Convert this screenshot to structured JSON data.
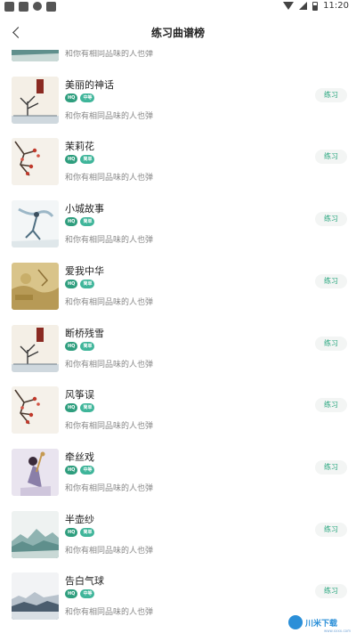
{
  "status_bar": {
    "time": "11:20",
    "left_icons": [
      "shield-icon",
      "image-icon",
      "bug-icon",
      "text-icon"
    ],
    "right_icons": [
      "wifi-icon",
      "signal-icon",
      "battery-icon"
    ]
  },
  "header": {
    "title": "练习曲谱榜",
    "back_icon": "chevron-left-icon"
  },
  "list": {
    "practice_label": "练习",
    "subtitle": "和你有相同品味的人也弹",
    "items": [
      {
        "title": "",
        "badges": [
          "HQ",
          "中等"
        ],
        "art": "landscape"
      },
      {
        "title": "美丽的神话",
        "badges": [
          "HQ",
          "中等"
        ],
        "art": "tree-seal"
      },
      {
        "title": "茉莉花",
        "badges": [
          "HQ",
          "简单"
        ],
        "art": "plum"
      },
      {
        "title": "小城故事",
        "badges": [
          "HQ",
          "简单"
        ],
        "art": "dancer"
      },
      {
        "title": "爱我中华",
        "badges": [
          "HQ",
          "简单"
        ],
        "art": "scroll"
      },
      {
        "title": "断桥残雪",
        "badges": [
          "HQ",
          "简单"
        ],
        "art": "tree-seal"
      },
      {
        "title": "风筝误",
        "badges": [
          "HQ",
          "简单"
        ],
        "art": "plum"
      },
      {
        "title": "牵丝戏",
        "badges": [
          "HQ",
          "中等"
        ],
        "art": "figure"
      },
      {
        "title": "半壶纱",
        "badges": [
          "HQ",
          "简单"
        ],
        "art": "landscape"
      },
      {
        "title": "告白气球",
        "badges": [
          "HQ",
          "中等"
        ],
        "art": "landscape-dark"
      }
    ]
  },
  "watermark": {
    "text": "川米下载",
    "sub": "www.xxxx.com"
  },
  "colors": {
    "accent": "#2aa77f",
    "badge": "#3fb59a",
    "button_bg": "#f3f5f4"
  }
}
